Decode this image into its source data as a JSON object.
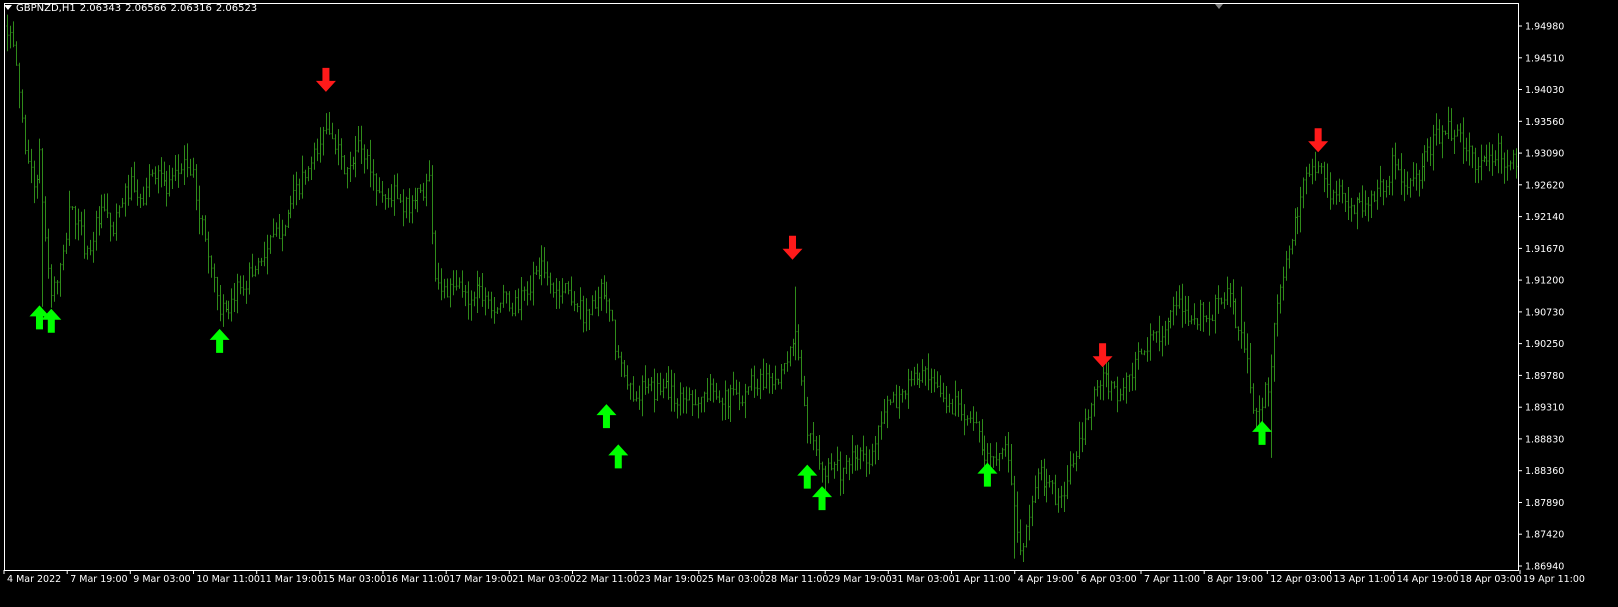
{
  "header": {
    "symbol_timeframe": "GBPNZD,H1",
    "open": "2.06343",
    "high": "2.06566",
    "low": "2.06316",
    "close": "2.06523"
  },
  "colors": {
    "background": "#000000",
    "foreground": "#ffffff",
    "bar": "#2f8b1a",
    "buy_arrow": "#00ff00",
    "sell_arrow": "#ff1a1a",
    "frame": "#ffffff"
  },
  "chart_data": {
    "type": "bar",
    "symbol": "GBPNZD",
    "timeframe": "H1",
    "grid": false,
    "ylim": [
      1.8694,
      1.9498
    ],
    "yticks": [
      "1.94980",
      "1.94510",
      "1.94030",
      "1.93560",
      "1.93090",
      "1.92620",
      "1.92140",
      "1.91670",
      "1.91200",
      "1.90730",
      "1.90250",
      "1.89780",
      "1.89310",
      "1.88830",
      "1.88360",
      "1.87890",
      "1.87420",
      "1.86940"
    ],
    "xticks": [
      "4 Mar 2022",
      "7 Mar 19:00",
      "9 Mar 03:00",
      "10 Mar 11:00",
      "11 Mar 19:00",
      "15 Mar 03:00",
      "16 Mar 11:00",
      "17 Mar 19:00",
      "21 Mar 03:00",
      "22 Mar 11:00",
      "23 Mar 19:00",
      "25 Mar 03:00",
      "28 Mar 11:00",
      "29 Mar 19:00",
      "31 Mar 03:00",
      "1 Apr 11:00",
      "4 Apr 19:00",
      "6 Apr 03:00",
      "7 Apr 11:00",
      "8 Apr 19:00",
      "12 Apr 03:00",
      "13 Apr 11:00",
      "14 Apr 19:00",
      "18 Apr 03:00",
      "19 Apr 11:00"
    ],
    "price_path": [
      [
        0,
        1.9498
      ],
      [
        3,
        1.944
      ],
      [
        6,
        1.932
      ],
      [
        9,
        1.926
      ],
      [
        11,
        1.93
      ],
      [
        13,
        1.918
      ],
      [
        15,
        1.91
      ],
      [
        17,
        1.912
      ],
      [
        19,
        1.915
      ],
      [
        21,
        1.923
      ],
      [
        24,
        1.92
      ],
      [
        27,
        1.916
      ],
      [
        30,
        1.92
      ],
      [
        33,
        1.922
      ],
      [
        36,
        1.919
      ],
      [
        39,
        1.924
      ],
      [
        42,
        1.926
      ],
      [
        45,
        1.923
      ],
      [
        48,
        1.927
      ],
      [
        51,
        1.929
      ],
      [
        54,
        1.925
      ],
      [
        57,
        1.927
      ],
      [
        60,
        1.93
      ],
      [
        63,
        1.927
      ],
      [
        66,
        1.92
      ],
      [
        69,
        1.914
      ],
      [
        72,
        1.908
      ],
      [
        75,
        1.906
      ],
      [
        78,
        1.911
      ],
      [
        81,
        1.912
      ],
      [
        84,
        1.914
      ],
      [
        87,
        1.916
      ],
      [
        90,
        1.918
      ],
      [
        93,
        1.92
      ],
      [
        96,
        1.923
      ],
      [
        99,
        1.926
      ],
      [
        102,
        1.928
      ],
      [
        105,
        1.931
      ],
      [
        108,
        1.935
      ],
      [
        110,
        1.9345
      ],
      [
        113,
        1.929
      ],
      [
        116,
        1.928
      ],
      [
        119,
        1.932
      ],
      [
        122,
        1.93
      ],
      [
        125,
        1.926
      ],
      [
        128,
        1.924
      ],
      [
        131,
        1.925
      ],
      [
        134,
        1.922
      ],
      [
        137,
        1.924
      ],
      [
        140,
        1.925
      ],
      [
        143,
        1.927
      ],
      [
        145,
        1.913
      ],
      [
        147,
        1.911
      ],
      [
        150,
        1.91
      ],
      [
        153,
        1.911
      ],
      [
        156,
        1.909
      ],
      [
        159,
        1.911
      ],
      [
        162,
        1.91
      ],
      [
        165,
        1.908
      ],
      [
        168,
        1.909
      ],
      [
        171,
        1.908
      ],
      [
        174,
        1.909
      ],
      [
        177,
        1.911
      ],
      [
        180,
        1.914
      ],
      [
        183,
        1.912
      ],
      [
        186,
        1.91
      ],
      [
        189,
        1.911
      ],
      [
        192,
        1.909
      ],
      [
        195,
        1.907
      ],
      [
        198,
        1.908
      ],
      [
        201,
        1.91
      ],
      [
        204,
        1.907
      ],
      [
        207,
        1.9
      ],
      [
        210,
        1.896
      ],
      [
        213,
        1.895
      ],
      [
        216,
        1.896
      ],
      [
        219,
        1.895
      ],
      [
        222,
        1.897
      ],
      [
        225,
        1.895
      ],
      [
        228,
        1.894
      ],
      [
        231,
        1.895
      ],
      [
        234,
        1.894
      ],
      [
        237,
        1.895
      ],
      [
        240,
        1.896
      ],
      [
        243,
        1.894
      ],
      [
        246,
        1.895
      ],
      [
        249,
        1.895
      ],
      [
        252,
        1.897
      ],
      [
        255,
        1.897
      ],
      [
        258,
        1.898
      ],
      [
        261,
        1.897
      ],
      [
        264,
        1.899
      ],
      [
        267,
        1.905
      ],
      [
        269,
        1.896
      ],
      [
        271,
        1.888
      ],
      [
        274,
        1.887
      ],
      [
        277,
        1.884
      ],
      [
        280,
        1.885
      ],
      [
        283,
        1.883
      ],
      [
        286,
        1.885
      ],
      [
        289,
        1.886
      ],
      [
        292,
        1.884
      ],
      [
        295,
        1.891
      ],
      [
        298,
        1.893
      ],
      [
        301,
        1.894
      ],
      [
        304,
        1.896
      ],
      [
        307,
        1.897
      ],
      [
        310,
        1.898
      ],
      [
        313,
        1.896
      ],
      [
        316,
        1.895
      ],
      [
        319,
        1.893
      ],
      [
        322,
        1.894
      ],
      [
        325,
        1.892
      ],
      [
        328,
        1.89
      ],
      [
        331,
        1.885
      ],
      [
        334,
        1.886
      ],
      [
        337,
        1.888
      ],
      [
        340,
        1.883
      ],
      [
        342,
        1.873
      ],
      [
        344,
        1.872
      ],
      [
        347,
        1.88
      ],
      [
        350,
        1.883
      ],
      [
        353,
        1.881
      ],
      [
        356,
        1.879
      ],
      [
        359,
        1.882
      ],
      [
        362,
        1.886
      ],
      [
        365,
        1.89
      ],
      [
        368,
        1.895
      ],
      [
        371,
        1.897
      ],
      [
        374,
        1.896
      ],
      [
        377,
        1.895
      ],
      [
        380,
        1.897
      ],
      [
        383,
        1.9
      ],
      [
        386,
        1.902
      ],
      [
        389,
        1.904
      ],
      [
        392,
        1.905
      ],
      [
        395,
        1.907
      ],
      [
        398,
        1.908
      ],
      [
        401,
        1.906
      ],
      [
        404,
        1.907
      ],
      [
        407,
        1.906
      ],
      [
        410,
        1.909
      ],
      [
        413,
        1.91
      ],
      [
        416,
        1.906
      ],
      [
        419,
        1.902
      ],
      [
        422,
        1.893
      ],
      [
        425,
        1.894
      ],
      [
        427,
        1.896
      ],
      [
        429,
        1.905
      ],
      [
        431,
        1.91
      ],
      [
        433,
        1.915
      ],
      [
        436,
        1.92
      ],
      [
        438,
        1.923
      ],
      [
        440,
        1.928
      ],
      [
        442,
        1.93
      ],
      [
        445,
        1.928
      ],
      [
        448,
        1.925
      ],
      [
        451,
        1.925
      ],
      [
        454,
        1.922
      ],
      [
        457,
        1.924
      ],
      [
        460,
        1.923
      ],
      [
        463,
        1.925
      ],
      [
        466,
        1.926
      ],
      [
        469,
        1.929
      ],
      [
        472,
        1.927
      ],
      [
        475,
        1.926
      ],
      [
        478,
        1.927
      ],
      [
        481,
        1.931
      ],
      [
        484,
        1.933
      ],
      [
        487,
        1.935
      ],
      [
        490,
        1.934
      ],
      [
        493,
        1.932
      ],
      [
        496,
        1.93
      ],
      [
        499,
        1.929
      ],
      [
        502,
        1.93
      ],
      [
        505,
        1.931
      ],
      [
        508,
        1.929
      ],
      [
        511,
        1.93
      ]
    ],
    "spikes": [
      {
        "bar": 12,
        "low": 1.908
      },
      {
        "bar": 18,
        "low": 1.9095
      },
      {
        "bar": 73,
        "low": 1.905
      },
      {
        "bar": 267,
        "high": 1.911
      },
      {
        "bar": 341,
        "low": 1.8705
      },
      {
        "bar": 344,
        "low": 1.87
      },
      {
        "bar": 428,
        "low": 1.8855
      },
      {
        "bar": 418,
        "high": 1.911
      },
      {
        "bar": 109,
        "high": 1.937
      },
      {
        "bar": 489,
        "high": 1.937
      }
    ],
    "signals": [
      {
        "type": "buy",
        "bar": 11,
        "price": 1.9082
      },
      {
        "type": "buy",
        "bar": 15,
        "price": 1.9077
      },
      {
        "type": "buy",
        "bar": 72,
        "price": 1.9047
      },
      {
        "type": "sell",
        "bar": 108,
        "price": 1.94
      },
      {
        "type": "buy",
        "bar": 203,
        "price": 1.8935
      },
      {
        "type": "buy",
        "bar": 207,
        "price": 1.8875
      },
      {
        "type": "sell",
        "bar": 266,
        "price": 1.915
      },
      {
        "type": "buy",
        "bar": 271,
        "price": 1.8845
      },
      {
        "type": "buy",
        "bar": 276,
        "price": 1.8813
      },
      {
        "type": "buy",
        "bar": 332,
        "price": 1.8848
      },
      {
        "type": "sell",
        "bar": 371,
        "price": 1.899
      },
      {
        "type": "buy",
        "bar": 425,
        "price": 1.891
      },
      {
        "type": "sell",
        "bar": 444,
        "price": 1.931
      }
    ]
  }
}
